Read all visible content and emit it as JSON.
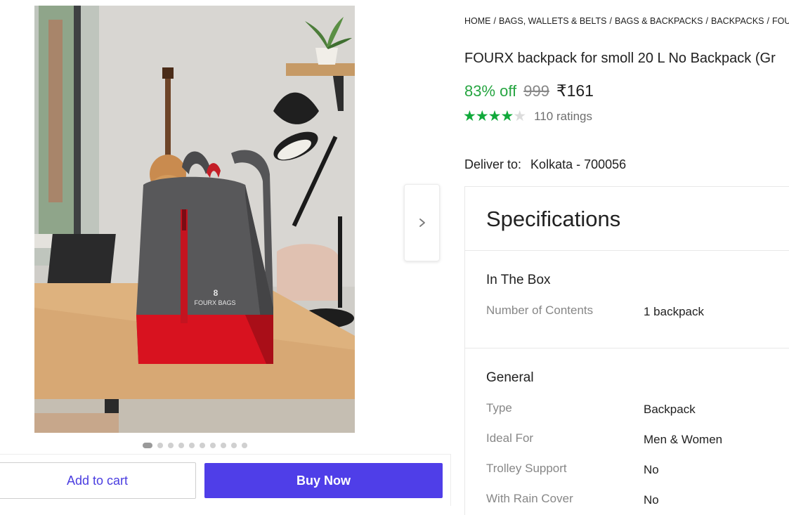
{
  "breadcrumb": [
    "HOME",
    "BAGS, WALLETS & BELTS",
    "BAGS & BACKPACKS",
    "BACKPACKS",
    "FOUR"
  ],
  "product": {
    "title": "FOURX backpack for smoll 20 L No Backpack (Gr",
    "image_brand_text": "FOURX BAGS",
    "discount": "83% off",
    "mrp": "999",
    "price": "₹161",
    "rating_stars": 4,
    "rating_max": 5,
    "ratings": "110 ratings"
  },
  "delivery": {
    "label": "Deliver to:",
    "location": "Kolkata - 700056"
  },
  "gallery": {
    "count": 10,
    "active_index": 0,
    "next_icon": "chevron-right-icon"
  },
  "actions": {
    "add_to_cart": "Add to cart",
    "buy_now": "Buy Now"
  },
  "specifications": {
    "title": "Specifications",
    "groups": [
      {
        "name": "In The Box",
        "rows": [
          {
            "key": "Number of Contents",
            "value": "1 backpack"
          }
        ]
      },
      {
        "name": "General",
        "rows": [
          {
            "key": "Type",
            "value": "Backpack"
          },
          {
            "key": "Ideal For",
            "value": "Men & Women"
          },
          {
            "key": "Trolley Support",
            "value": "No"
          },
          {
            "key": "With Rain Cover",
            "value": "No"
          }
        ]
      }
    ]
  },
  "colors": {
    "discount": "#26a541",
    "star": "#10a93a",
    "buy_button": "#4f3ee8",
    "cart_text": "#4a3de0"
  }
}
